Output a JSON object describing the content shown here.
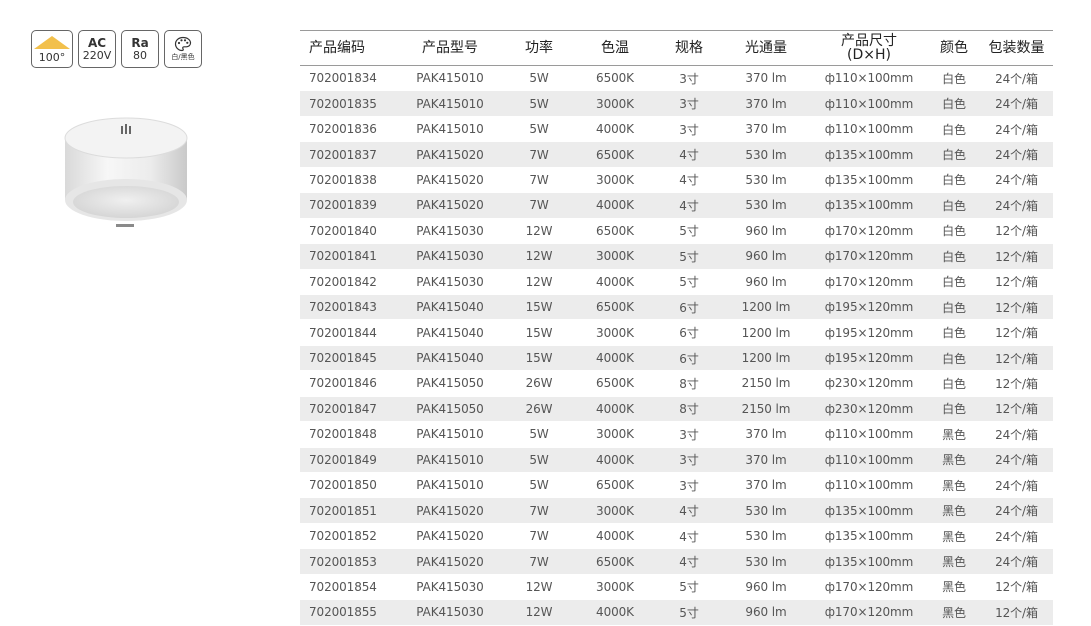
{
  "badges": {
    "beam_angle": "100°",
    "voltage_top": "AC",
    "voltage_bottom": "220V",
    "cri_top": "Ra",
    "cri_bottom": "80",
    "color_label": "白/黑色"
  },
  "colors": {
    "beam_accent": "#f2c04c",
    "row_stripe": "#ececec",
    "rule": "#9a9a9a"
  },
  "table": {
    "headers": [
      "产品编码",
      "产品型号",
      "功率",
      "色温",
      "规格",
      "光通量",
      "产品尺寸",
      "颜色",
      "包装数量"
    ],
    "size_header_sub": "(D×H)",
    "rows": [
      [
        "702001834",
        "PAK415010",
        "5W",
        "6500K",
        "3寸",
        "370 lm",
        "ф110×100mm",
        "白色",
        "24个/箱"
      ],
      [
        "702001835",
        "PAK415010",
        "5W",
        "3000K",
        "3寸",
        "370 lm",
        "ф110×100mm",
        "白色",
        "24个/箱"
      ],
      [
        "702001836",
        "PAK415010",
        "5W",
        "4000K",
        "3寸",
        "370 lm",
        "ф110×100mm",
        "白色",
        "24个/箱"
      ],
      [
        "702001837",
        "PAK415020",
        "7W",
        "6500K",
        "4寸",
        "530 lm",
        "ф135×100mm",
        "白色",
        "24个/箱"
      ],
      [
        "702001838",
        "PAK415020",
        "7W",
        "3000K",
        "4寸",
        "530 lm",
        "ф135×100mm",
        "白色",
        "24个/箱"
      ],
      [
        "702001839",
        "PAK415020",
        "7W",
        "4000K",
        "4寸",
        "530 lm",
        "ф135×100mm",
        "白色",
        "24个/箱"
      ],
      [
        "702001840",
        "PAK415030",
        "12W",
        "6500K",
        "5寸",
        "960 lm",
        "ф170×120mm",
        "白色",
        "12个/箱"
      ],
      [
        "702001841",
        "PAK415030",
        "12W",
        "3000K",
        "5寸",
        "960 lm",
        "ф170×120mm",
        "白色",
        "12个/箱"
      ],
      [
        "702001842",
        "PAK415030",
        "12W",
        "4000K",
        "5寸",
        "960 lm",
        "ф170×120mm",
        "白色",
        "12个/箱"
      ],
      [
        "702001843",
        "PAK415040",
        "15W",
        "6500K",
        "6寸",
        "1200 lm",
        "ф195×120mm",
        "白色",
        "12个/箱"
      ],
      [
        "702001844",
        "PAK415040",
        "15W",
        "3000K",
        "6寸",
        "1200 lm",
        "ф195×120mm",
        "白色",
        "12个/箱"
      ],
      [
        "702001845",
        "PAK415040",
        "15W",
        "4000K",
        "6寸",
        "1200 lm",
        "ф195×120mm",
        "白色",
        "12个/箱"
      ],
      [
        "702001846",
        "PAK415050",
        "26W",
        "6500K",
        "8寸",
        "2150 lm",
        "ф230×120mm",
        "白色",
        "12个/箱"
      ],
      [
        "702001847",
        "PAK415050",
        "26W",
        "4000K",
        "8寸",
        "2150 lm",
        "ф230×120mm",
        "白色",
        "12个/箱"
      ],
      [
        "702001848",
        "PAK415010",
        "5W",
        "3000K",
        "3寸",
        "370 lm",
        "ф110×100mm",
        "黑色",
        "24个/箱"
      ],
      [
        "702001849",
        "PAK415010",
        "5W",
        "4000K",
        "3寸",
        "370 lm",
        "ф110×100mm",
        "黑色",
        "24个/箱"
      ],
      [
        "702001850",
        "PAK415010",
        "5W",
        "6500K",
        "3寸",
        "370 lm",
        "ф110×100mm",
        "黑色",
        "24个/箱"
      ],
      [
        "702001851",
        "PAK415020",
        "7W",
        "3000K",
        "4寸",
        "530 lm",
        "ф135×100mm",
        "黑色",
        "24个/箱"
      ],
      [
        "702001852",
        "PAK415020",
        "7W",
        "4000K",
        "4寸",
        "530 lm",
        "ф135×100mm",
        "黑色",
        "24个/箱"
      ],
      [
        "702001853",
        "PAK415020",
        "7W",
        "6500K",
        "4寸",
        "530 lm",
        "ф135×100mm",
        "黑色",
        "24个/箱"
      ],
      [
        "702001854",
        "PAK415030",
        "12W",
        "3000K",
        "5寸",
        "960 lm",
        "ф170×120mm",
        "黑色",
        "12个/箱"
      ],
      [
        "702001855",
        "PAK415030",
        "12W",
        "4000K",
        "5寸",
        "960 lm",
        "ф170×120mm",
        "黑色",
        "12个/箱"
      ]
    ]
  }
}
